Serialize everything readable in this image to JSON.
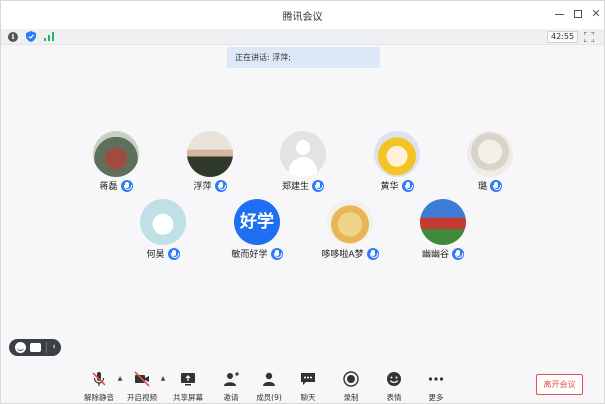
{
  "window": {
    "title": "腾讯会议"
  },
  "infobar": {
    "timer": "42:55"
  },
  "speaking": {
    "label": "正在讲话: 浮萍;"
  },
  "participants": [
    {
      "name": "蒋磊",
      "avatar": "lab-photo"
    },
    {
      "name": "浮萍",
      "avatar": "man-photo"
    },
    {
      "name": "郑建生",
      "avatar": "default"
    },
    {
      "name": "黄华",
      "avatar": "naruto"
    },
    {
      "name": "璐",
      "avatar": "sketch"
    },
    {
      "name": "何昊",
      "avatar": "cute"
    },
    {
      "name": "敏而好学",
      "avatar": "text",
      "avatar_text": "好学"
    },
    {
      "name": "哆哆啦A梦",
      "avatar": "dog"
    },
    {
      "name": "幽幽谷",
      "avatar": "house"
    }
  ],
  "toolbar": {
    "unmute": "解除静音",
    "start_video": "开启视频",
    "share_screen": "共享屏幕",
    "invite": "邀请",
    "members": "成员(9)",
    "chat": "聊天",
    "record": "录制",
    "reactions": "表情",
    "more": "更多",
    "leave": "离开会议"
  },
  "colors": {
    "accent": "#2e7cf6",
    "leave": "#e0534a",
    "muted": "#e0534a"
  }
}
